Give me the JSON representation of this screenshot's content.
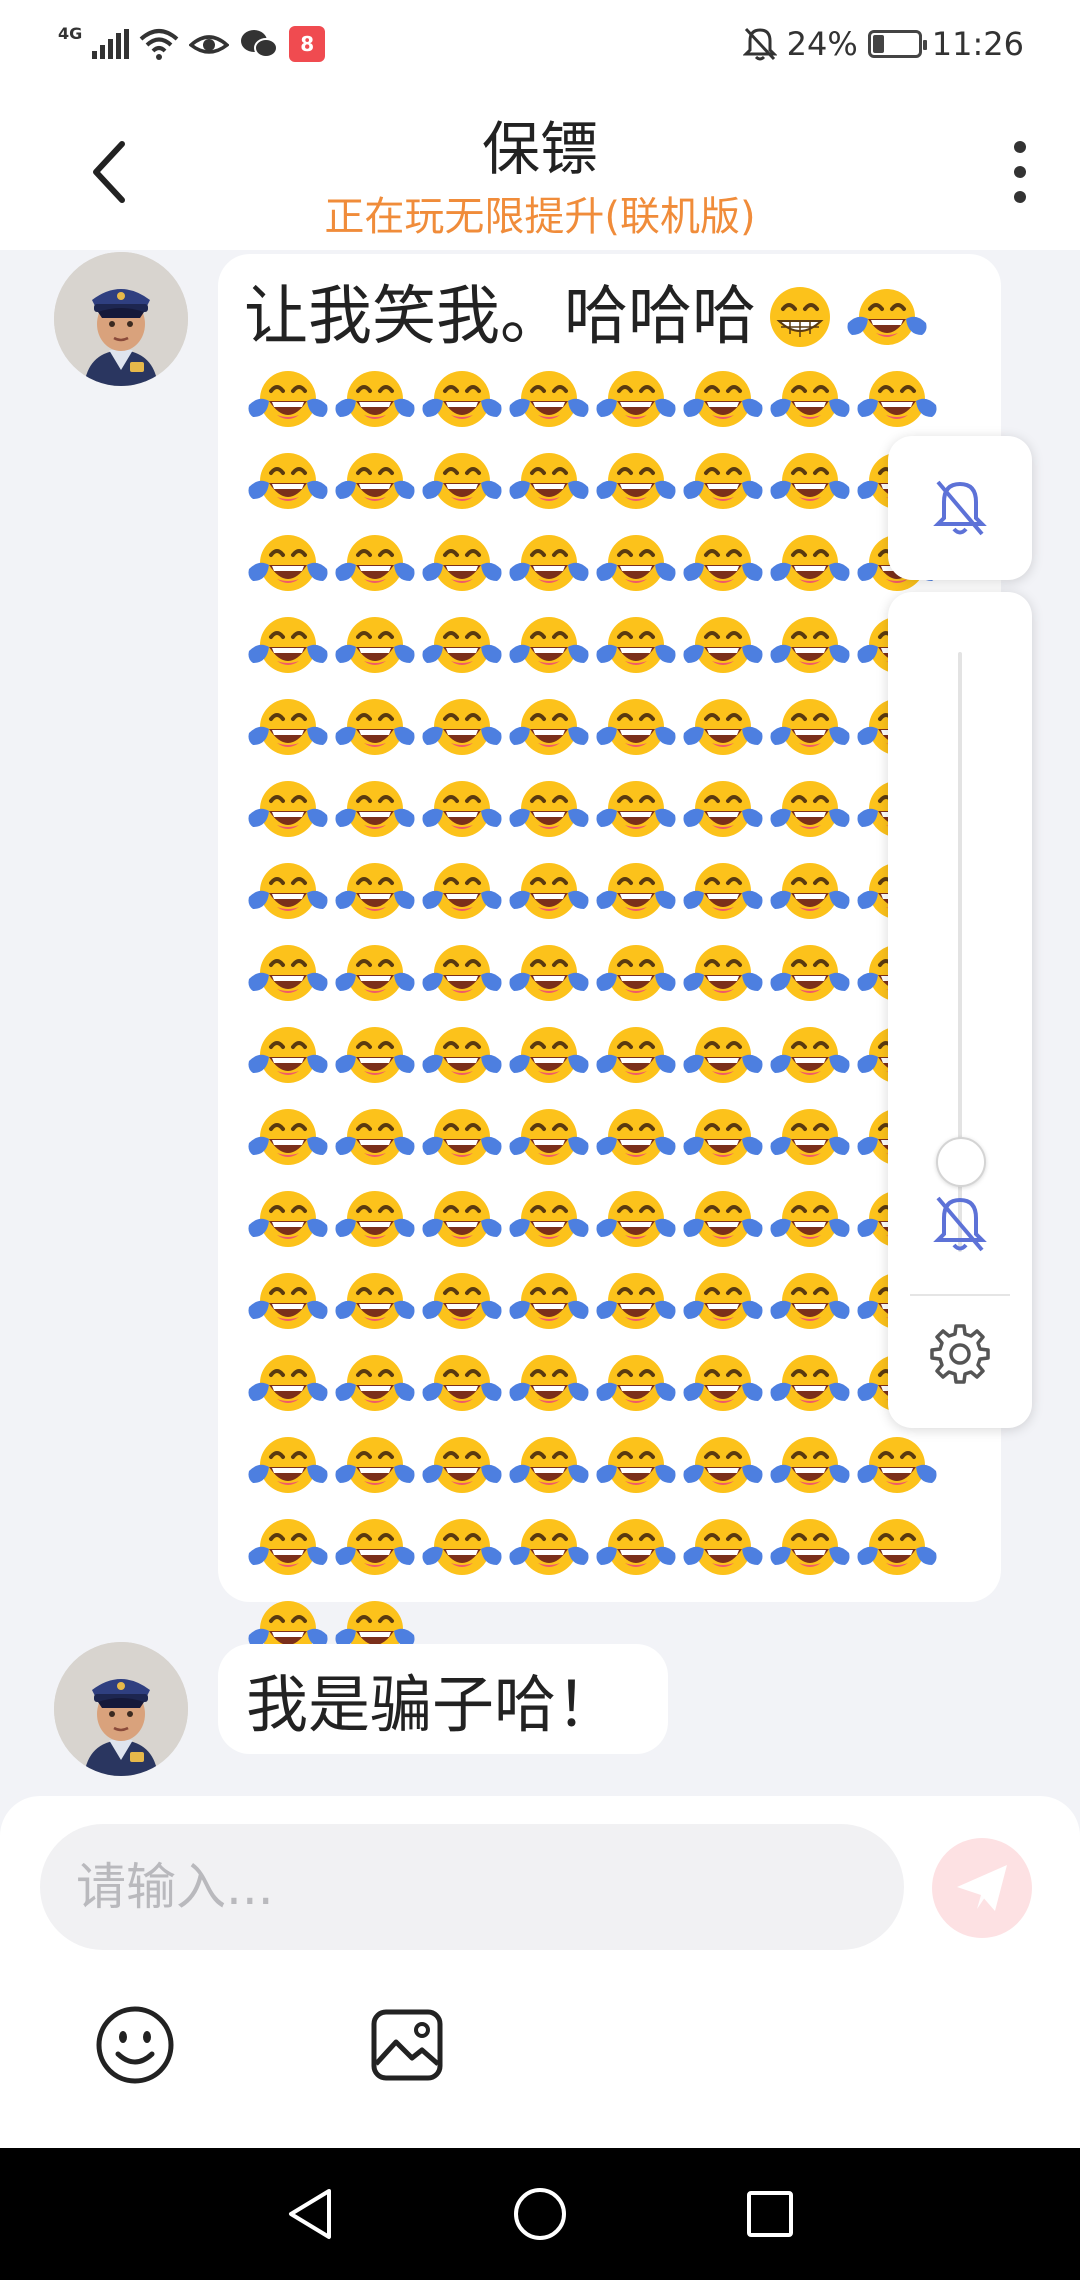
{
  "status_bar": {
    "network": "4G",
    "battery": "24%",
    "battery_level": 0.24,
    "time": "11:26",
    "app_badge": "8"
  },
  "header": {
    "title": "保镖",
    "subtitle": "正在玩无限提升(联机版)"
  },
  "messages": [
    {
      "sender": "保镖",
      "text": "让我笑我。哈哈哈",
      "emoji_grin": "grinning-face-with-smiling-eyes",
      "emoji_laugh": "face-with-tears-of-joy",
      "laugh_count": 123
    },
    {
      "sender": "保镖",
      "text": "我是骗子哈！"
    }
  ],
  "volume_panel": {
    "top_icon": "bell-muted-icon",
    "level": 0.0,
    "bottom_icon": "bell-muted-icon",
    "settings_icon": "gear-icon",
    "accent": "#5d72d7"
  },
  "input": {
    "placeholder": "请输入...",
    "value": ""
  },
  "colors": {
    "subtitle": "#f08c3a",
    "send_button": "#fde1e3",
    "background": "#f2f3f7"
  }
}
